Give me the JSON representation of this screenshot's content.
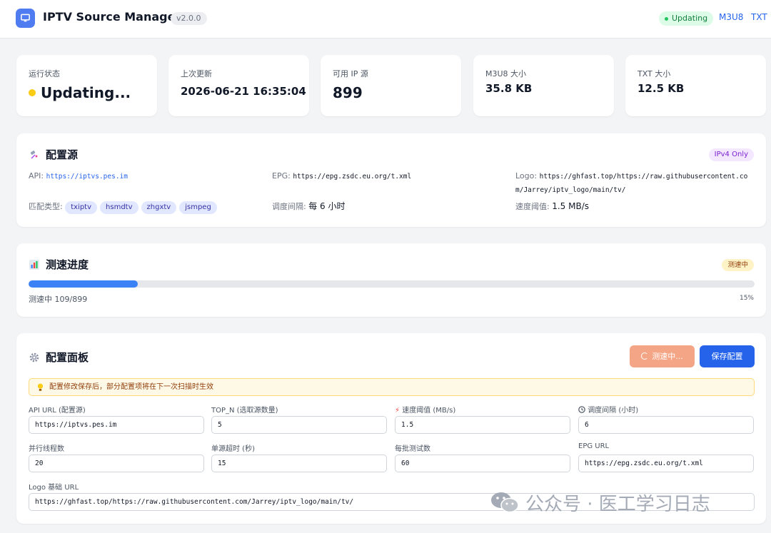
{
  "header": {
    "title": "IPTV Source Manager",
    "version": "v2.0.0",
    "status": "Updating",
    "links": [
      "M3U8",
      "TXT"
    ]
  },
  "stats": [
    {
      "label": "运行状态",
      "value": "Updating..."
    },
    {
      "label": "上次更新",
      "value": "2026-06-21 16:35:04"
    },
    {
      "label": "可用 IP 源",
      "value": "899"
    },
    {
      "label": "M3U8 大小",
      "value": "35.8 KB"
    },
    {
      "label": "TXT 大小",
      "value": "12.5 KB"
    }
  ],
  "config_source": {
    "title": "配置源",
    "badge": "IPv4 Only",
    "api_label": "API:",
    "api_value": "https://iptvs.pes.im",
    "epg_label": "EPG:",
    "epg_value": "https://epg.zsdc.eu.org/t.xml",
    "logo_label": "Logo:",
    "logo_value": "https://ghfast.top/https://raw.githubusercontent.com/Jarrey/iptv_logo/main/tv/",
    "match_label": "匹配类型:",
    "match_tags": [
      "txiptv",
      "hsmdtv",
      "zhgxtv",
      "jsmpeg"
    ],
    "interval_label": "调度间隔:",
    "interval_value": "每 6 小时",
    "speed_label": "速度阈值:",
    "speed_value": "1.5 MB/s"
  },
  "progress": {
    "title": "测速进度",
    "badge": "测速中",
    "text": "测速中 109/899",
    "percent_label": "15%",
    "fraction": 0.15
  },
  "config_panel": {
    "title": "配置面板",
    "test_button": "测速中...",
    "save_button": "保存配置",
    "notice": "配置修改保存后，部分配置项将在下一次扫描时生效",
    "fields": {
      "api_url": {
        "label": "API URL (配置源)",
        "value": "https://iptvs.pes.im"
      },
      "top_n": {
        "label": "TOP_N (选取源数量)",
        "value": "5"
      },
      "speed": {
        "label": "速度阈值 (MB/s)",
        "value": "1.5"
      },
      "interval": {
        "label": "调度间隔 (小时)",
        "value": "6"
      },
      "threads": {
        "label": "并行线程数",
        "value": "20"
      },
      "timeout": {
        "label": "单源超时 (秒)",
        "value": "15"
      },
      "batch": {
        "label": "每批测试数",
        "value": "60"
      },
      "epg_url": {
        "label": "EPG URL",
        "value": "https://epg.zsdc.eu.org/t.xml"
      },
      "logo_url": {
        "label": "Logo 基础 URL",
        "value": "https://ghfast.top/https://raw.githubusercontent.com/Jarrey/iptv_logo/main/tv/"
      }
    }
  },
  "watermark": "公众号 · 医工学习日志",
  "colors": {
    "accent": "#2563eb",
    "progress": "#3b82f6",
    "updating_dot": "#facc15",
    "test_button": "#f4a585"
  }
}
